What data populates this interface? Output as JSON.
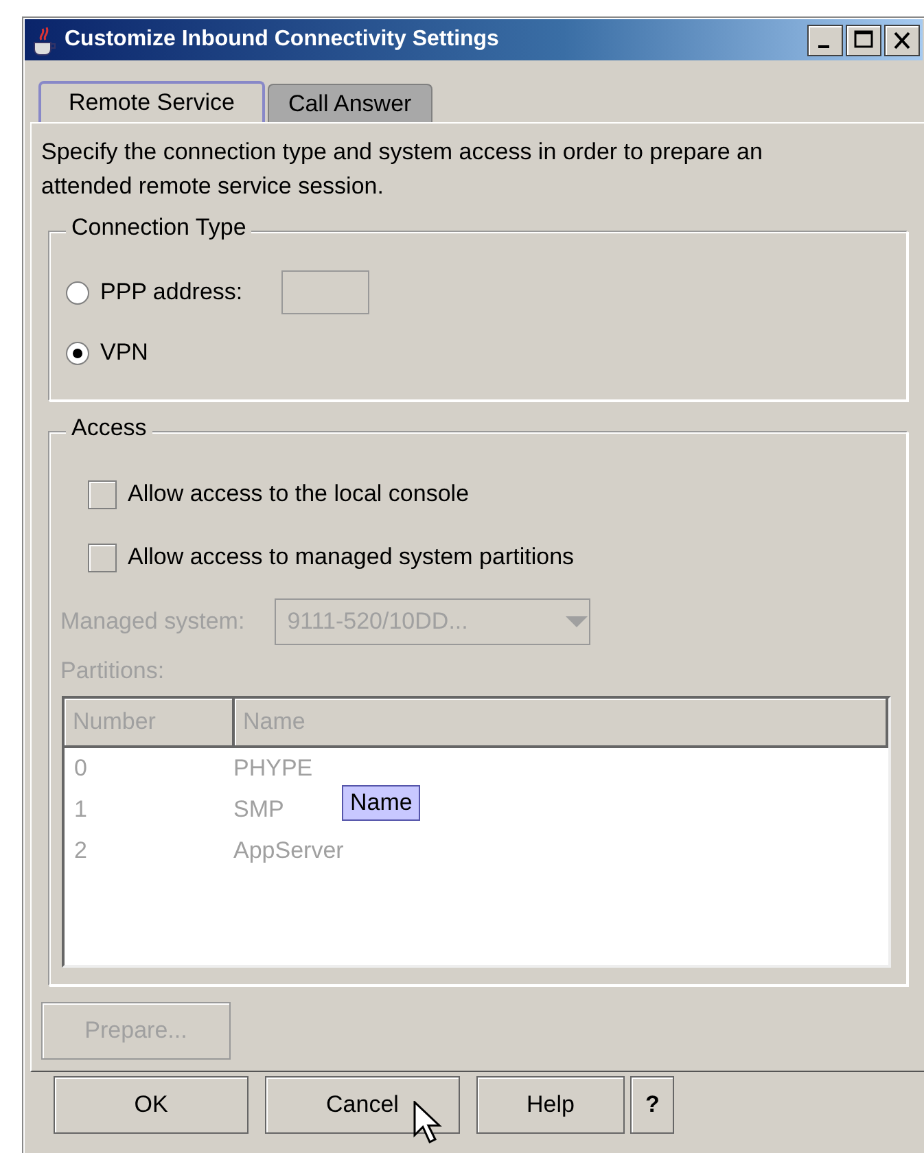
{
  "window": {
    "title": "Customize Inbound Connectivity Settings"
  },
  "tabs": [
    {
      "label": "Remote Service",
      "selected": true
    },
    {
      "label": "Call Answer",
      "selected": false
    }
  ],
  "description": "Specify the connection type and system access in order to prepare an attended remote service session.",
  "connection_type": {
    "title": "Connection Type",
    "options": [
      {
        "kind": "radio-field",
        "label": "PPP address:",
        "selected": false
      },
      {
        "kind": "radio",
        "label": "VPN",
        "selected": true
      }
    ]
  },
  "access": {
    "title": "Access",
    "checkboxes": [
      {
        "label": "Allow access to the local console",
        "checked": false
      },
      {
        "label": "Allow access to managed system partitions",
        "checked": false
      }
    ],
    "managed_system": {
      "label": "Managed system:",
      "value": "9111-520/10DD...",
      "disabled": true
    },
    "partitions": {
      "label": "Partitions:",
      "disabled": true,
      "columns": [
        "Number",
        "Name"
      ],
      "rows": [
        [
          "0",
          "PHYPE"
        ],
        [
          "1",
          "SMP"
        ],
        [
          "2",
          "AppServer"
        ]
      ],
      "tooltip": "Name"
    }
  },
  "prepare_button": {
    "label": "Prepare...",
    "disabled": true
  },
  "buttons": [
    {
      "kind": "text",
      "label": "OK"
    },
    {
      "kind": "text",
      "label": "Cancel"
    },
    {
      "kind": "text",
      "label": "Help"
    },
    {
      "kind": "help",
      "label": "?"
    }
  ]
}
